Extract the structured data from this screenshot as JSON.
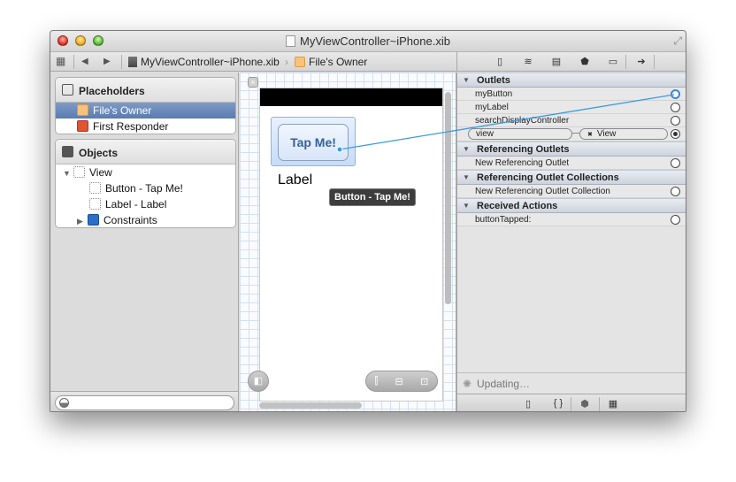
{
  "window": {
    "title": "MyViewController~iPhone.xib"
  },
  "navbar": {
    "breadcrumbs": [
      "MyViewController~iPhone.xib",
      "File's Owner"
    ],
    "back_glyph": "◀",
    "forward_glyph": "▶",
    "related_glyph": "▦",
    "crumb_sep": "›"
  },
  "inspector_tabs": [
    {
      "name": "file-inspector",
      "glyph": "▯"
    },
    {
      "name": "quick-help",
      "glyph": "≋"
    },
    {
      "name": "identity-inspector",
      "glyph": "▤"
    },
    {
      "name": "attributes-inspector",
      "glyph": "⬟"
    },
    {
      "name": "size-inspector",
      "glyph": "▭"
    },
    {
      "name": "connections-inspector",
      "glyph": "➔"
    }
  ],
  "document_outline": {
    "placeholders": {
      "title": "Placeholders",
      "items": [
        {
          "label": "File's Owner",
          "selected": true
        },
        {
          "label": "First Responder",
          "selected": false
        }
      ]
    },
    "objects": {
      "title": "Objects",
      "items": [
        {
          "label": "View",
          "expanded": true
        },
        {
          "label": "Button - Tap Me!"
        },
        {
          "label": "Label - Label"
        },
        {
          "label": "Constraints",
          "expanded": false
        }
      ]
    },
    "filter_placeholder": ""
  },
  "canvas": {
    "button_text": "Tap Me!",
    "label_text": "Label",
    "tooltip": "Button - Tap Me!",
    "close_glyph": "×",
    "zoom_glyph": "◧",
    "align_glyphs": [
      "⫿",
      "⊟",
      "⊡"
    ]
  },
  "connections": {
    "sections": [
      {
        "title": "Outlets",
        "rows": [
          {
            "name": "myButton",
            "state": "connecting"
          },
          {
            "name": "myLabel",
            "state": "empty"
          },
          {
            "name": "searchDisplayController",
            "state": "empty"
          },
          {
            "name": "view",
            "state": "connected",
            "target": "View"
          }
        ]
      },
      {
        "title": "Referencing Outlets",
        "rows": [
          {
            "name": "New Referencing Outlet",
            "state": "empty"
          }
        ]
      },
      {
        "title": "Referencing Outlet Collections",
        "rows": [
          {
            "name": "New Referencing Outlet Collection",
            "state": "empty"
          }
        ]
      },
      {
        "title": "Received Actions",
        "rows": [
          {
            "name": "buttonTapped:",
            "state": "empty"
          }
        ]
      }
    ],
    "disconnect_glyph": "✖"
  },
  "status": {
    "text": "Updating…"
  },
  "library_tabs": [
    {
      "name": "file-templates",
      "glyph": "▯"
    },
    {
      "name": "code-snippets",
      "glyph": "{ }"
    },
    {
      "name": "object-library",
      "glyph": "⬢"
    },
    {
      "name": "media-library",
      "glyph": "▦"
    }
  ],
  "colors": {
    "selection": "#5a7bb0",
    "connection_line": "#3a9be0"
  }
}
